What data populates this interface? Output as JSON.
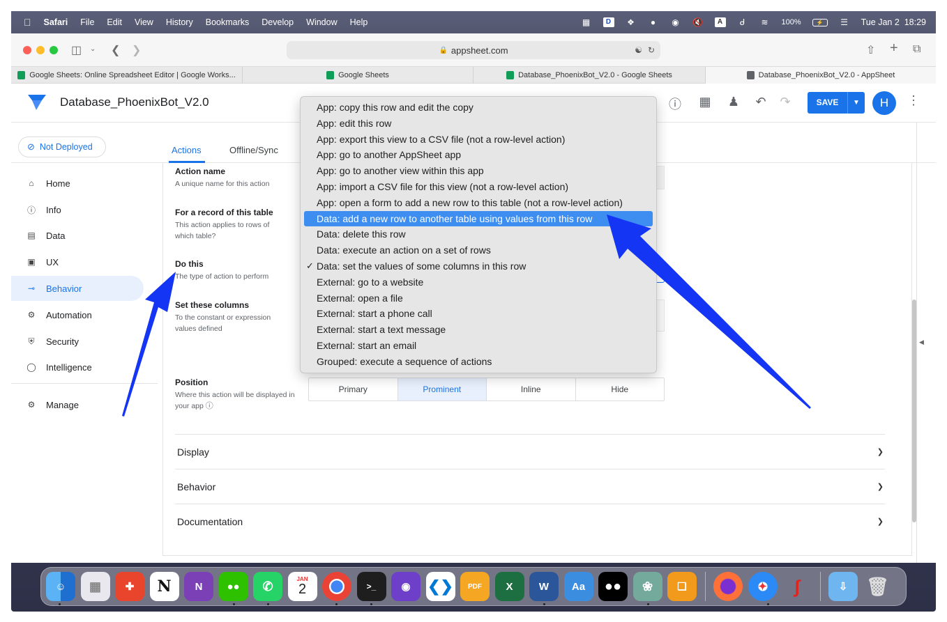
{
  "menubar": {
    "app_name": "Safari",
    "menus": [
      "File",
      "Edit",
      "View",
      "History",
      "Bookmarks",
      "Develop",
      "Window",
      "Help"
    ],
    "battery": "100%",
    "datetime": "Tue Jan 2  18:29",
    "status_icons": [
      "photos-icon",
      "dashlane-icon",
      "dropbox-icon",
      "wechat-icon",
      "grammarly-icon",
      "mute-icon",
      "input-source-icon",
      "bluetooth-icon",
      "wifi-icon",
      "battery-icon",
      "control-center-icon"
    ],
    "input_source": "A"
  },
  "browser": {
    "url": "appsheet.com",
    "tabs": [
      {
        "label": "Google Sheets: Online Spreadsheet Editor | Google Works...",
        "favicon_color": "#0f9d58",
        "active": false
      },
      {
        "label": "Google Sheets",
        "favicon_color": "#0f9d58",
        "active": false
      },
      {
        "label": "Database_PhoenixBot_V2.0 - Google Sheets",
        "favicon_color": "#0f9d58",
        "active": false
      },
      {
        "label": "Database_PhoenixBot_V2.0 - AppSheet",
        "favicon_color": "#5f6368",
        "active": true
      }
    ]
  },
  "app": {
    "title": "Database_PhoenixBot_V2.0",
    "save_label": "SAVE",
    "avatar_initial": "H",
    "accent_color": "#1a73e8"
  },
  "sidebar": {
    "deploy_status": "Not Deployed",
    "items": [
      {
        "label": "Home",
        "icon": "home-icon",
        "active": false
      },
      {
        "label": "Info",
        "icon": "info-icon",
        "active": false
      },
      {
        "label": "Data",
        "icon": "data-icon",
        "active": false
      },
      {
        "label": "UX",
        "icon": "ux-icon",
        "active": false
      },
      {
        "label": "Behavior",
        "icon": "behavior-icon",
        "active": true
      },
      {
        "label": "Automation",
        "icon": "automation-icon",
        "active": false
      },
      {
        "label": "Security",
        "icon": "security-icon",
        "active": false
      },
      {
        "label": "Intelligence",
        "icon": "intelligence-icon",
        "active": false
      }
    ],
    "manage_label": "Manage"
  },
  "subtabs": [
    "Actions",
    "Offline/Sync"
  ],
  "form": {
    "action_name": {
      "label": "Action name",
      "help": "A unique name for this action"
    },
    "record_table": {
      "label": "For a record of this table",
      "help": "This action applies to rows of which table?"
    },
    "do_this": {
      "label": "Do this",
      "help": "The type of action to perform"
    },
    "set_columns": {
      "label": "Set these columns",
      "help": "To the constant or expression values defined"
    },
    "position": {
      "label": "Position",
      "help": "Where this action will be displayed in your app",
      "options": [
        "Primary",
        "Prominent",
        "Inline",
        "Hide"
      ],
      "selected": "Prominent"
    }
  },
  "sections": [
    "Display",
    "Behavior",
    "Documentation"
  ],
  "dropdown": {
    "items": [
      "App: copy this row and edit the copy",
      "App: edit this row",
      "App: export this view to a CSV file (not a row-level action)",
      "App: go to another AppSheet app",
      "App: go to another view within this app",
      "App: import a CSV file for this view (not a row-level action)",
      "App: open a form to add a new row to this table (not a row-level action)",
      "Data: add a new row to another table using values from this row",
      "Data: delete this row",
      "Data: execute an action on a set of rows",
      "Data: set the values of some columns in this row",
      "External: go to a website",
      "External: open a file",
      "External: start a phone call",
      "External: start a text message",
      "External: start an email",
      "Grouped: execute a sequence of actions"
    ],
    "highlighted": "Data: add a new row to another table using values from this row",
    "checked": "Data: set the values of some columns in this row",
    "highlight_color": "#3d8ef0"
  },
  "annotation_arrow_color": "#1535f5",
  "dock": {
    "calendar_month": "JAN",
    "calendar_day": "2",
    "apps": [
      "finder-icon",
      "launchpad-icon",
      "xmind-icon",
      "notion-icon",
      "onenote-icon",
      "wechat-icon",
      "whatsapp-icon",
      "calendar-icon",
      "chrome-icon",
      "terminal-icon",
      "github-desktop-icon",
      "vscode-icon",
      "pdf-expert-icon",
      "excel-icon",
      "word-icon",
      "dictionary-icon",
      "medium-icon",
      "chatgpt-icon",
      "pages-icon",
      "firefox-icon",
      "safari-icon",
      "screen-capture-icon",
      "downloads-icon",
      "trash-icon"
    ]
  }
}
